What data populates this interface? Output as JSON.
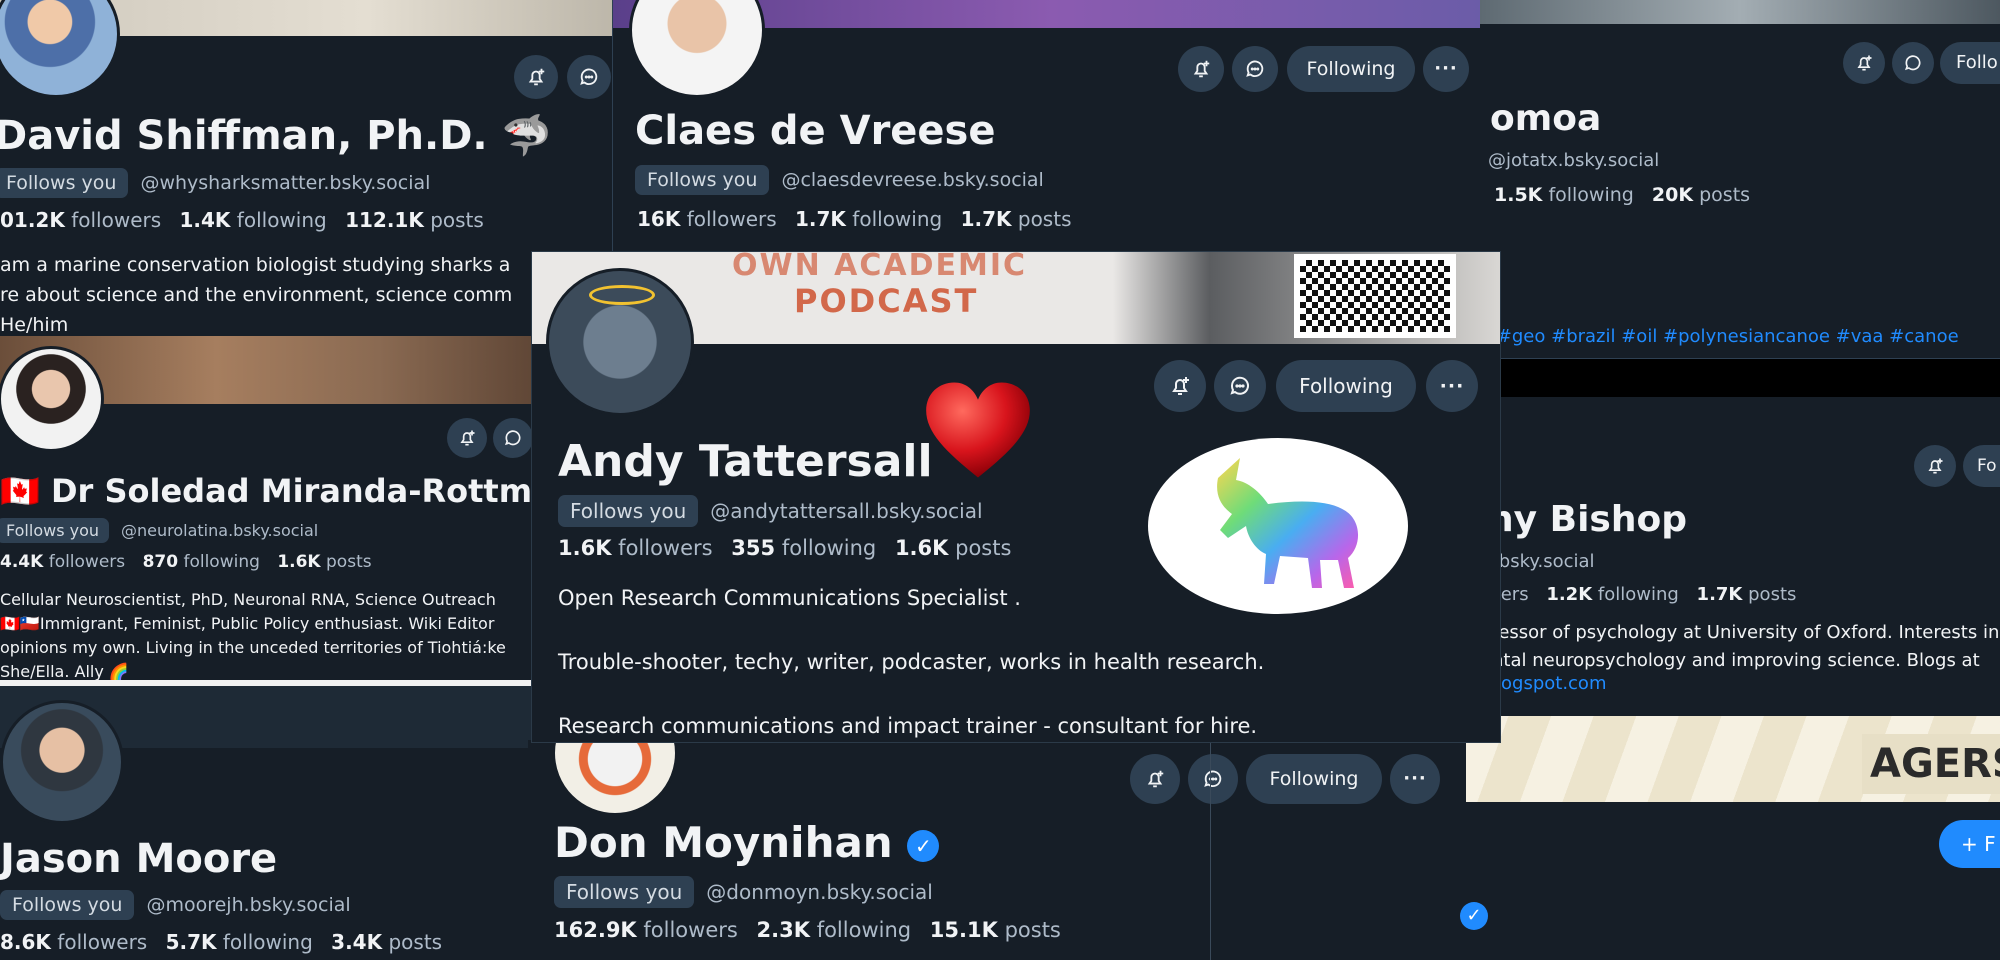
{
  "profiles": {
    "shiffman": {
      "name": "David Shiffman, Ph.D.",
      "name_emoji": "🦈",
      "follows_you": "Follows you",
      "handle": "@whysharksmatter.bsky.social",
      "followers": "01.2K",
      "followers_label": "followers",
      "following": "1.4K",
      "following_label": "following",
      "posts": "112.1K",
      "posts_label": "posts",
      "bio": "am a marine conservation biologist studying sharks a\nre about science and the environment, science comm\nHe/him"
    },
    "devreese": {
      "name": "Claes de Vreese",
      "follows_you": "Follows you",
      "handle": "@claesdevreese.bsky.social",
      "followers": "16K",
      "followers_label": "followers",
      "following": "1.7K",
      "following_label": "following",
      "posts": "1.7K",
      "posts_label": "posts",
      "following_button": "Following",
      "more_button": "···"
    },
    "jotatx": {
      "name": "omoa",
      "handle": "@jotatx.bsky.social",
      "following": "1.5K",
      "following_label": "following",
      "posts": "20K",
      "posts_label": "posts",
      "following_button": "Follo",
      "tags": "e #geo #brazil #oil #polynesiancanoe #vaa #canoe"
    },
    "miranda": {
      "name_flag": "🇨🇦",
      "name": "Dr Soledad Miranda-Rottmar",
      "follows_you": "Follows you",
      "handle": "@neurolatina.bsky.social",
      "followers": "4.4K",
      "followers_label": "followers",
      "following": "870",
      "following_label": "following",
      "posts": "1.6K",
      "posts_label": "posts",
      "bio": "Cellular Neuroscientist, PhD, Neuronal RNA, Science Outreach\n🇨🇦🇨🇱Immigrant,  Feminist, Public Policy enthusiast. Wiki Editor\nopinions my own. Living in the unceded territories of Tiohtiá:ke\nShe/Ella. Ally 🌈"
    },
    "tattersall": {
      "banner_line1": "OWN ACADEMIC",
      "banner_line2": "PODCAST",
      "name": "Andy Tattersall",
      "follows_you": "Follows you",
      "handle": "@andytattersall.bsky.social",
      "followers": "1.6K",
      "followers_label": "followers",
      "following": "355",
      "following_label": "following",
      "posts": "1.6K",
      "posts_label": "posts",
      "following_button": "Following",
      "more_button": "···",
      "bio": "Open Research Communications Specialist .\n\nTrouble-shooter, techy, writer, podcaster, works in health research.\n\nResearch communications and impact trainer - consultant for hire."
    },
    "bishop": {
      "name": "hy Bishop",
      "handle": "e.bsky.social",
      "followers_label": "wers",
      "following": "1.2K",
      "following_label": "following",
      "posts": "1.7K",
      "posts_label": "posts",
      "bio": "fessor of psychology at University of Oxford. Interests in\nntal neuropsychology and improving science. Blogs at",
      "link": "logspot.com",
      "following_button": "Fo"
    },
    "moore": {
      "name": "Jason Moore",
      "follows_you": "Follows you",
      "handle": "@moorejh.bsky.social",
      "followers": "8.6K",
      "followers_label": "followers",
      "following": "5.7K",
      "following_label": "following",
      "posts": "3.4K",
      "posts_label": "posts"
    },
    "moynihan": {
      "name": "Don Moynihan",
      "follows_you": "Follows you",
      "handle": "@donmoyn.bsky.social",
      "followers": "162.9K",
      "followers_label": "followers",
      "following": "2.3K",
      "following_label": "following",
      "posts": "15.1K",
      "posts_label": "posts",
      "following_button": "Following",
      "more_button": "···"
    },
    "far_right": {
      "banner_text": "AGERS",
      "follow_button": "+ F"
    }
  },
  "icons": {
    "bell": "bell-plus-icon",
    "chat": "chat-bubble-icon",
    "verified": "verified-badge-icon",
    "heart": "heart-emoji",
    "unicorn": "rainbow-unicorn-sticker"
  },
  "colors": {
    "background": "#161e27",
    "button": "#2e4052",
    "text": "#f1f3f5",
    "muted": "#aebbc9",
    "accent": "#208bfe"
  }
}
